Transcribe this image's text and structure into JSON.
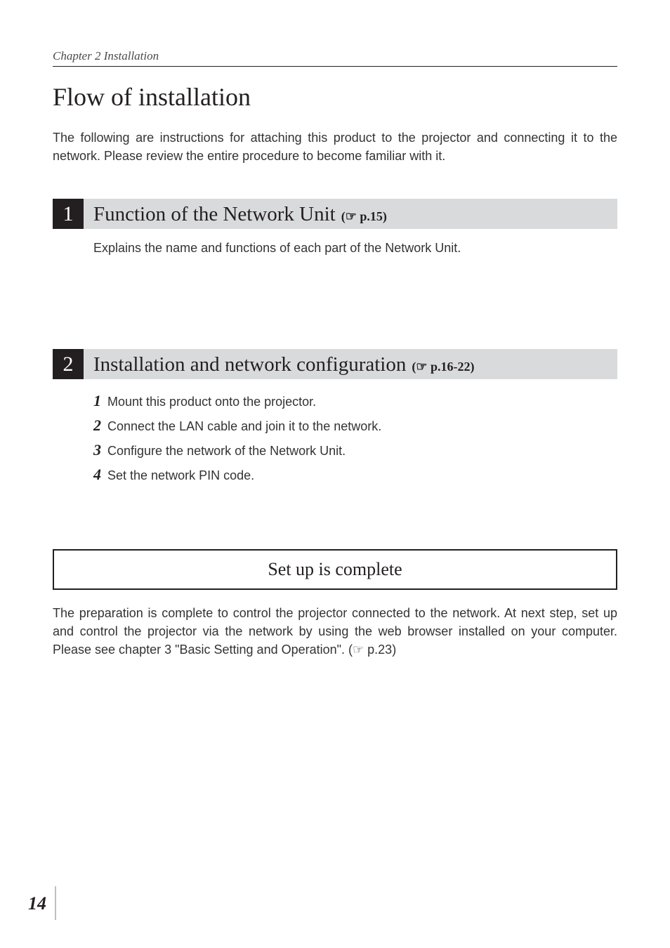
{
  "running_header": "Chapter 2 Installation",
  "page_title": "Flow of installation",
  "intro": "The following are instructions for attaching this product to the projector and connecting it to the network. Please review the entire procedure to become familiar with it.",
  "section1": {
    "num": "1",
    "title": "Function of the Network Unit",
    "pageref": "(☞ p.15)",
    "body": "Explains the name and functions of each part of the Network Unit."
  },
  "section2": {
    "num": "2",
    "title": "Installation and network configuration",
    "pageref": "(☞ p.16-22)",
    "steps": [
      {
        "n": "1",
        "t": " Mount this product onto the projector."
      },
      {
        "n": "2",
        "t": " Connect the LAN cable and join it to the network."
      },
      {
        "n": "3",
        "t": " Configure the network of the Network Unit."
      },
      {
        "n": "4",
        "t": " Set the network PIN code."
      }
    ]
  },
  "complete_label": "Set up is complete",
  "closing": "The preparation is complete to control the projector connected to the network. At next step, set up and control the projector via the network by using the web browser installed on your computer. Please see chapter 3 \"Basic Setting and Operation\". (☞ p.23)",
  "page_number": "14"
}
